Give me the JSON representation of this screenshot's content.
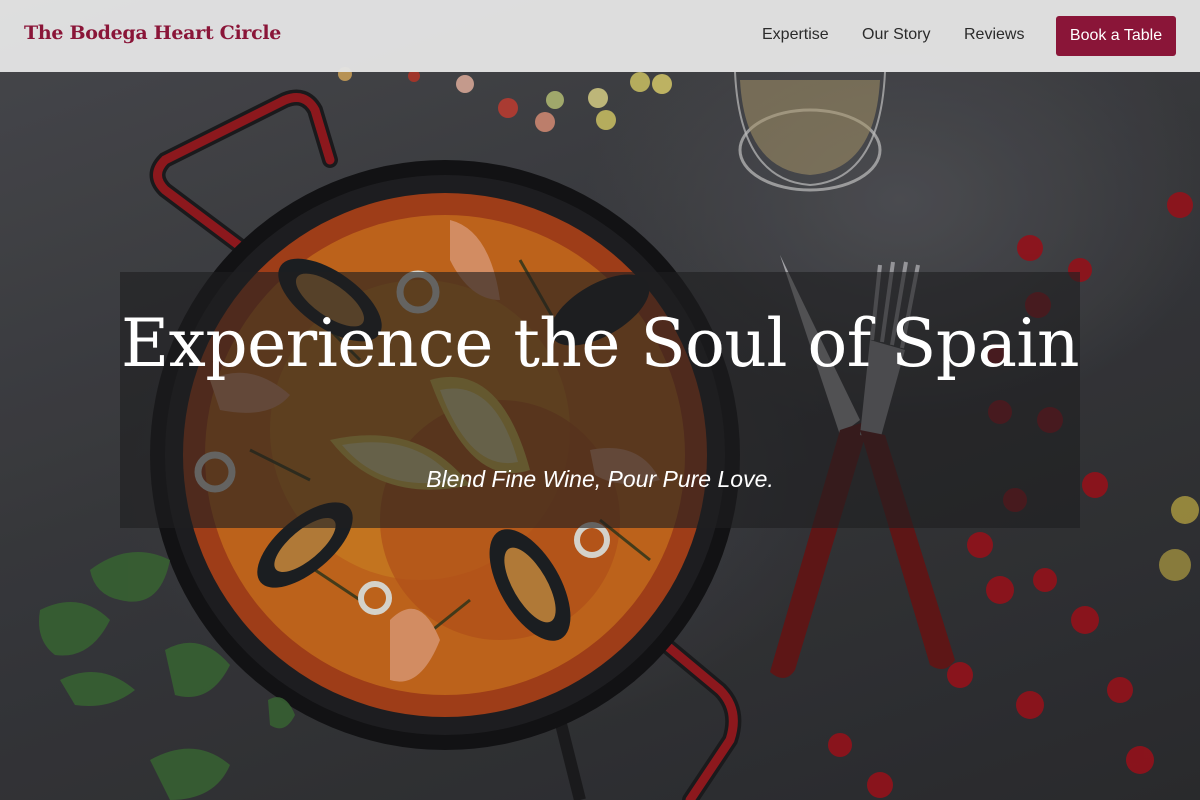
{
  "nav": {
    "brand": "The Bodega Heart Circle",
    "links": [
      {
        "label": "Expertise"
      },
      {
        "label": "Our Story"
      },
      {
        "label": "Reviews"
      }
    ],
    "cta_label": "Book a Table"
  },
  "hero": {
    "headline": "Experience the Soul of Spain",
    "tagline": "Blend Fine Wine, Pour Pure Love.",
    "background_image": "paella pan with seafood, lemon wedges, wine glass, knife and fork, red berries on dark stone surface"
  },
  "colors": {
    "brand": "#8a1538",
    "nav_background": "#e4e4e4",
    "nav_text": "#2b2b2b",
    "hero_text": "#ffffff"
  }
}
